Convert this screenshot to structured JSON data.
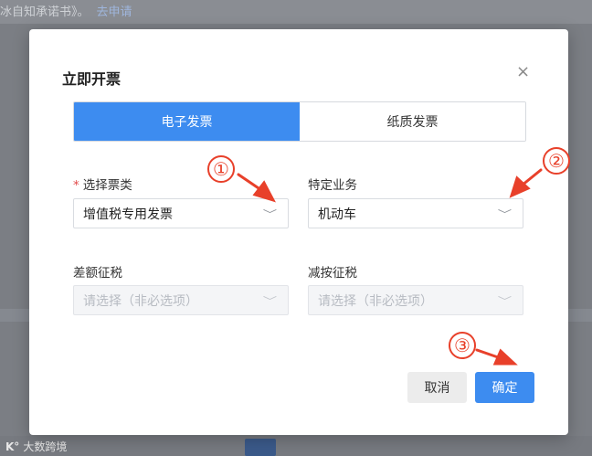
{
  "background": {
    "top_text": "冰自知承诺书》。",
    "top_link": "去申请"
  },
  "watermark": {
    "mark": "K°",
    "text": "大数跨境"
  },
  "modal": {
    "title": "立即开票",
    "close_glyph": "×",
    "tabs": [
      {
        "label": "电子发票",
        "active": true
      },
      {
        "label": "纸质发票",
        "active": false
      }
    ],
    "fields": {
      "ticket_type": {
        "label": "选择票类",
        "required_mark": "*",
        "value": "增值税专用发票"
      },
      "special_business": {
        "label": "特定业务",
        "value": "机动车"
      },
      "difference_tax": {
        "label": "差额征税",
        "placeholder": "请选择（非必选项）"
      },
      "reduced_tax": {
        "label": "减按征税",
        "placeholder": "请选择（非必选项）"
      }
    },
    "buttons": {
      "cancel": "取消",
      "confirm": "确定"
    }
  },
  "annotations": {
    "step1": "①",
    "step2": "②",
    "step3": "③"
  },
  "colors": {
    "accent": "#3d8cf0",
    "annotation": "#e8402a",
    "required": "#e24a4a"
  },
  "icons": {
    "select_caret": "﹀"
  }
}
